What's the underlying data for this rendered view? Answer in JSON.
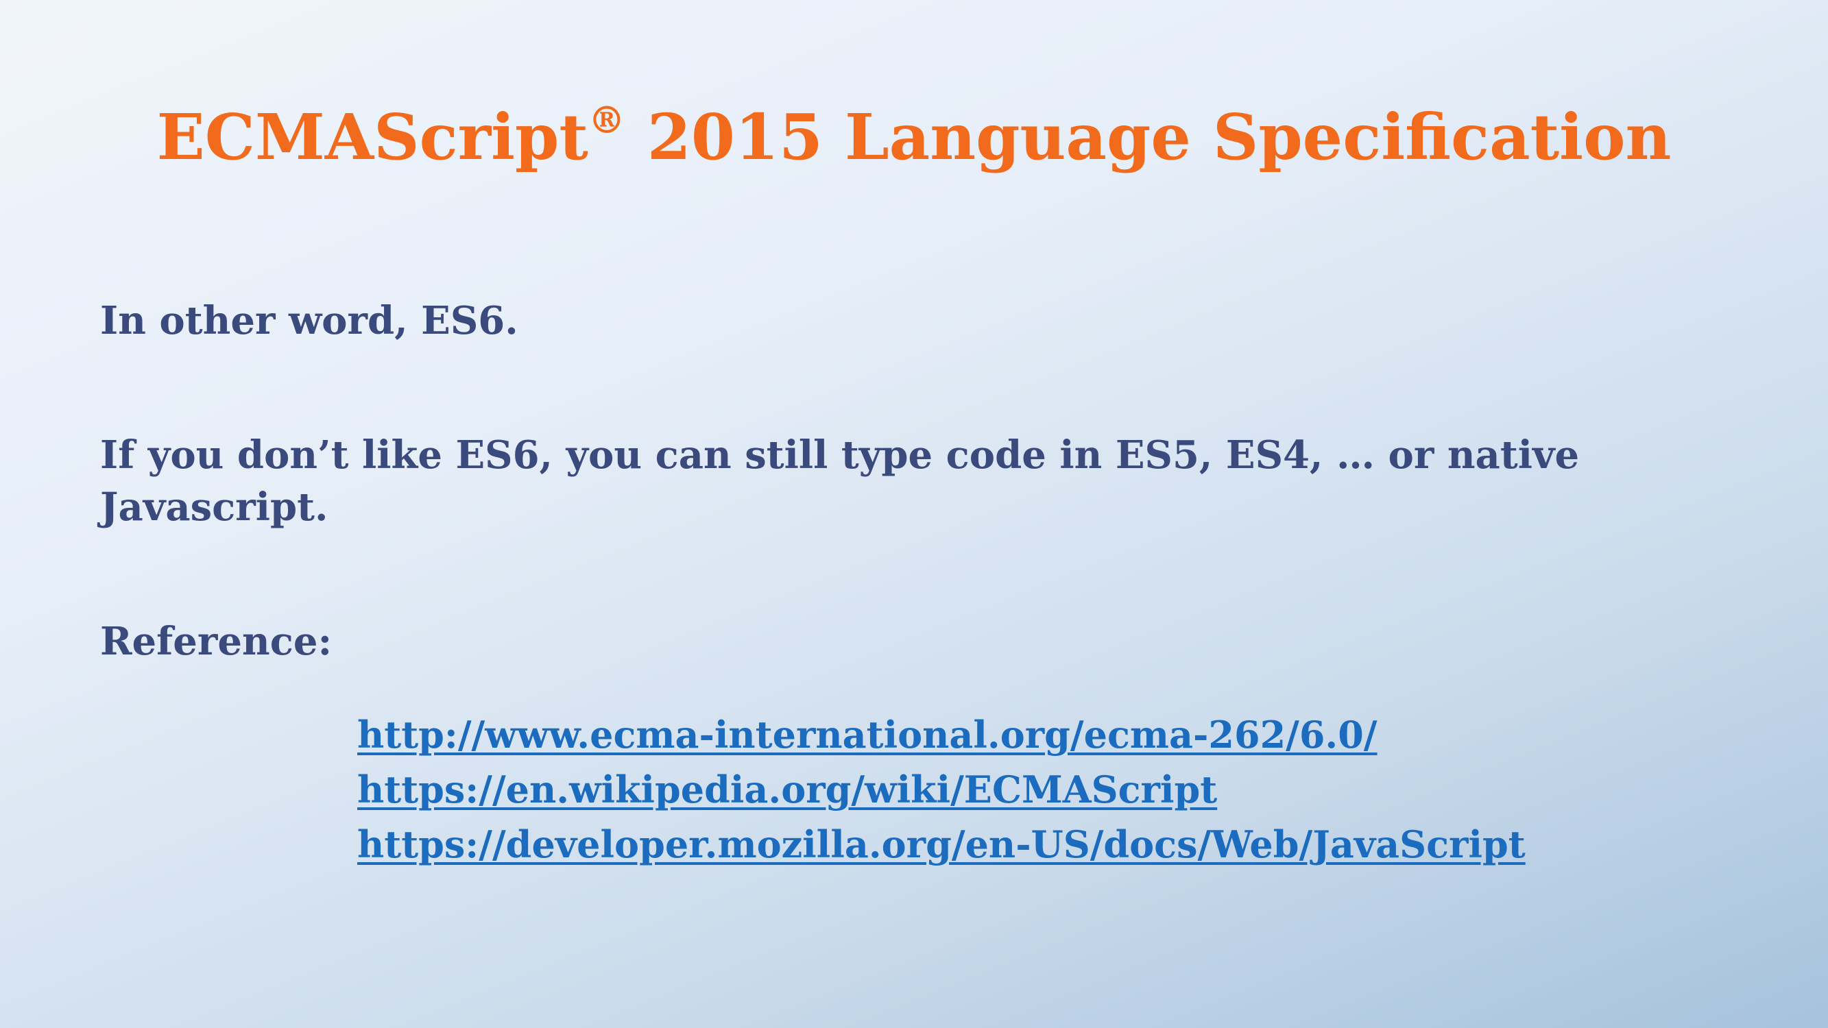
{
  "slide": {
    "title": "ECMAScript",
    "title_mark": "®",
    "title_rest": " 2015 Language Specification",
    "line1": "In other word, ES6.",
    "line2a": "If you don’t like ES6, you can still type code in ES5, ES4, … or native",
    "line2b": "Javascript.",
    "reference_label": "Reference:",
    "links": [
      "http://www.ecma-international.org/ecma-262/6.0/",
      "https://en.wikipedia.org/wiki/ECMAScript",
      "https://developer.mozilla.org/en-US/docs/Web/JavaScript"
    ]
  },
  "colors": {
    "title": "#f26a1b",
    "body_text": "#3a4a7c",
    "link": "#1b6bbf"
  }
}
